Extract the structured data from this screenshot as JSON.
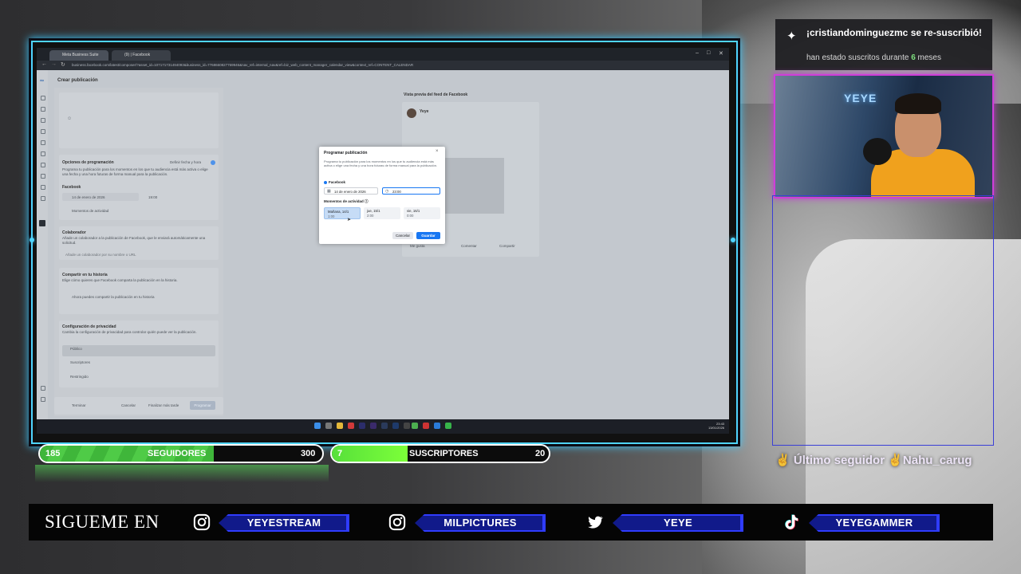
{
  "browser": {
    "tabs": [
      {
        "label": "Meta Business Suite"
      },
      {
        "label": "(9) | Facebook"
      }
    ],
    "url": "business.facebook.com/latest/composer/?asset_id=107171731494093&business_id=7768660827769946&nav_ref=internal_nav&ref=biz_web_content_manager_calendar_view&context_ref=CONTENT_CALENDAR"
  },
  "app": {
    "title": "Crear publicación",
    "panel": {
      "programacion_title": "Opciones de programación",
      "programacion_toggle": "Definir fecha y hora",
      "programacion_desc": "Programa tu publicación para los momentos en los que tu audiencia está más activa o elige una fecha y una hora futuras de forma manual para la publicación.",
      "facebook_label": "Facebook",
      "date": "14 de enero de 2026",
      "time": "19:00",
      "momentos": "Momentos de actividad",
      "colaborador_title": "Colaborador",
      "colaborador_desc": "Añade un colaborador a la publicación de Facebook, que le enviará automáticamente una solicitud.",
      "colaborador_placeholder": "Añade un colaborador por su nombre o URL",
      "historia_title": "Compartir en tu historia",
      "historia_desc": "Elige cómo quieres que Facebook comparta la publicación en la historia.",
      "historia_option": "Ahora puedes compartir la publicación en tu historia",
      "privacidad_title": "Configuración de privacidad",
      "privacidad_desc": "Cambia la configuración de privacidad para controlar quién puede ver la publicación.",
      "privacidad_options": [
        "Público",
        "Suscriptores",
        "Restringido"
      ],
      "footer_left": "Terminar",
      "footer_cancel": "Cancelar",
      "footer_schedule": "Finalizar más tarde",
      "footer_publish": "Programar"
    },
    "preview": {
      "title": "Vista previa del feed de Facebook",
      "page_name": "Yeye",
      "actions": [
        "Me gusta",
        "Comentar",
        "Compartir"
      ]
    }
  },
  "modal": {
    "title": "Programar publicación",
    "close": "×",
    "description": "Programa tu publicación para los momentos en los que tu audiencia está más activa o elige una fecha y una hora futuras de forma manual para la publicación.",
    "facebook_label": "Facebook",
    "date_value": "14 de enero de 2026",
    "time_value": "23:00",
    "momentos_title": "Momentos de actividad",
    "slots": [
      {
        "day": "Mañana, 14/1",
        "time": "1:00"
      },
      {
        "day": "jue, 15/1",
        "time": "2:00"
      },
      {
        "day": "vie, 16/1",
        "time": "0:00"
      }
    ],
    "cancel": "Cancelar",
    "save": "Guardar"
  },
  "taskbar": {
    "time": "23:43",
    "date": "13/01/2026"
  },
  "notification": {
    "main": "¡cristiandominguezmc se re-suscribió!",
    "sub_prefix": "han estado suscritos durante ",
    "months": "6",
    "sub_suffix": " meses"
  },
  "webcam": {
    "sign": "YEYE"
  },
  "ultimo": {
    "label": "Último seguidor",
    "name": "Nahu_carug"
  },
  "bars": {
    "seguidores": {
      "label": "SEGUIDORES",
      "current": "185",
      "goal": "300",
      "progress": 0.617
    },
    "suscriptores": {
      "label": "SUSCRIPTORES",
      "current": "7",
      "goal": "20",
      "progress": 0.35
    }
  },
  "social": {
    "title": "SIGUEME EN",
    "links": [
      {
        "platform": "instagram-icon",
        "handle": "YEYESTREAM"
      },
      {
        "platform": "instagram-icon",
        "handle": "MILPICTURES"
      },
      {
        "platform": "twitter-icon",
        "handle": "YEYE"
      },
      {
        "platform": "tiktok-icon",
        "handle": "YEYEGAMMER"
      }
    ]
  },
  "colors": {
    "accent_cyan": "#4fd5ff",
    "webcam_border": "#d03ed9",
    "bar_green": "#4fcb47",
    "social_blue": "#111a8a",
    "fb_blue": "#1877f2"
  }
}
